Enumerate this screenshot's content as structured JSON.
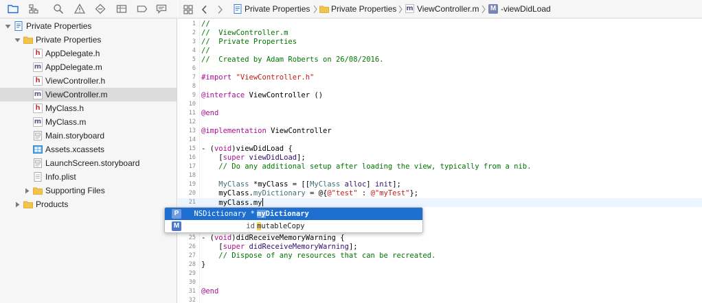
{
  "navigator": {
    "toolbar_icons": [
      "project-navigator-icon",
      "symbol-navigator-icon",
      "find-navigator-icon",
      "issue-navigator-icon",
      "test-navigator-icon",
      "debug-navigator-icon",
      "breakpoint-navigator-icon",
      "report-navigator-icon"
    ],
    "tree": [
      {
        "label": "Private Properties",
        "kind": "project",
        "indent": 0,
        "disclosure": "open"
      },
      {
        "label": "Private Properties",
        "kind": "folder",
        "indent": 1,
        "disclosure": "open"
      },
      {
        "label": "AppDelegate.h",
        "kind": "h",
        "indent": 2
      },
      {
        "label": "AppDelegate.m",
        "kind": "m",
        "indent": 2
      },
      {
        "label": "ViewController.h",
        "kind": "h",
        "indent": 2
      },
      {
        "label": "ViewController.m",
        "kind": "m",
        "indent": 2,
        "selected": true
      },
      {
        "label": "MyClass.h",
        "kind": "h",
        "indent": 2
      },
      {
        "label": "MyClass.m",
        "kind": "m",
        "indent": 2
      },
      {
        "label": "Main.storyboard",
        "kind": "storyboard",
        "indent": 2
      },
      {
        "label": "Assets.xcassets",
        "kind": "assets",
        "indent": 2
      },
      {
        "label": "LaunchScreen.storyboard",
        "kind": "storyboard",
        "indent": 2
      },
      {
        "label": "Info.plist",
        "kind": "plist",
        "indent": 2
      },
      {
        "label": "Supporting Files",
        "kind": "folder",
        "indent": 2,
        "disclosure": "closed"
      },
      {
        "label": "Products",
        "kind": "folder",
        "indent": 1,
        "disclosure": "closed"
      }
    ]
  },
  "jumpbar": {
    "items": [
      "Private Properties",
      "Private Properties",
      "ViewController.m",
      "-viewDidLoad"
    ],
    "method_badge": "M"
  },
  "editor": {
    "lines": [
      {
        "n": "1",
        "tokens": [
          [
            "c-comment",
            "//"
          ]
        ]
      },
      {
        "n": "2",
        "tokens": [
          [
            "c-comment",
            "//  ViewController.m"
          ]
        ]
      },
      {
        "n": "3",
        "tokens": [
          [
            "c-comment",
            "//  Private Properties"
          ]
        ]
      },
      {
        "n": "4",
        "tokens": [
          [
            "c-comment",
            "//"
          ]
        ]
      },
      {
        "n": "5",
        "tokens": [
          [
            "c-comment",
            "//  Created by Adam Roberts on 26/08/2016."
          ]
        ]
      },
      {
        "n": "6",
        "tokens": []
      },
      {
        "n": "7",
        "tokens": [
          [
            "c-kw",
            "#import "
          ],
          [
            "c-str",
            "\"ViewController.h\""
          ]
        ]
      },
      {
        "n": "8",
        "tokens": []
      },
      {
        "n": "9",
        "tokens": [
          [
            "c-kw",
            "@interface "
          ],
          [
            "c-plain",
            "ViewController ()"
          ]
        ]
      },
      {
        "n": "10",
        "tokens": []
      },
      {
        "n": "11",
        "tokens": [
          [
            "c-kw",
            "@end"
          ]
        ]
      },
      {
        "n": "12",
        "tokens": []
      },
      {
        "n": "13",
        "tokens": [
          [
            "c-kw",
            "@implementation "
          ],
          [
            "c-plain",
            "ViewController"
          ]
        ]
      },
      {
        "n": "14",
        "tokens": []
      },
      {
        "n": "15",
        "tokens": [
          [
            "c-plain",
            "- ("
          ],
          [
            "c-kw",
            "void"
          ],
          [
            "c-plain",
            ")viewDidLoad {"
          ]
        ]
      },
      {
        "n": "16",
        "tokens": [
          [
            "c-plain",
            "    ["
          ],
          [
            "c-kw",
            "super "
          ],
          [
            "c-meth",
            "viewDidLoad"
          ],
          [
            "c-plain",
            "];"
          ]
        ]
      },
      {
        "n": "17",
        "tokens": [
          [
            "c-comment",
            "    // Do any additional setup after loading the view, typically from a nib."
          ]
        ]
      },
      {
        "n": "18",
        "tokens": []
      },
      {
        "n": "19",
        "tokens": [
          [
            "c-plain",
            "    "
          ],
          [
            "c-prop",
            "MyClass"
          ],
          [
            "c-plain",
            " *myClass = [["
          ],
          [
            "c-prop",
            "MyClass"
          ],
          [
            "c-plain",
            " "
          ],
          [
            "c-meth",
            "alloc"
          ],
          [
            "c-plain",
            "] "
          ],
          [
            "c-meth",
            "init"
          ],
          [
            "c-plain",
            "];"
          ]
        ]
      },
      {
        "n": "20",
        "tokens": [
          [
            "c-plain",
            "    myClass."
          ],
          [
            "c-prop",
            "myDictionary"
          ],
          [
            "c-plain",
            " = @{"
          ],
          [
            "c-str",
            "@\"test\""
          ],
          [
            "c-plain",
            " : "
          ],
          [
            "c-str",
            "@\"myTest\""
          ],
          [
            "c-plain",
            "};"
          ]
        ]
      },
      {
        "n": "21",
        "tokens": [
          [
            "c-plain",
            "    myClass.my"
          ]
        ],
        "current": true
      },
      {
        "n": "22",
        "tokens": []
      },
      {
        "n": "23",
        "tokens": []
      },
      {
        "n": "24",
        "tokens": []
      },
      {
        "n": "25",
        "tokens": [
          [
            "c-plain",
            "- ("
          ],
          [
            "c-kw",
            "void"
          ],
          [
            "c-plain",
            ")didReceiveMemoryWarning {"
          ]
        ]
      },
      {
        "n": "26",
        "tokens": [
          [
            "c-plain",
            "    ["
          ],
          [
            "c-kw",
            "super "
          ],
          [
            "c-meth",
            "didReceiveMemoryWarning"
          ],
          [
            "c-plain",
            "];"
          ]
        ]
      },
      {
        "n": "27",
        "tokens": [
          [
            "c-comment",
            "    // Dispose of any resources that can be recreated."
          ]
        ]
      },
      {
        "n": "28",
        "tokens": [
          [
            "c-plain",
            "}"
          ]
        ]
      },
      {
        "n": "29",
        "tokens": []
      },
      {
        "n": "30",
        "tokens": []
      },
      {
        "n": "31",
        "tokens": [
          [
            "c-kw",
            "@end"
          ]
        ]
      },
      {
        "n": "32",
        "tokens": []
      }
    ]
  },
  "completion": {
    "items": [
      {
        "badge": "P",
        "badge_color": "#4a77c6",
        "type": "NSDictionary *",
        "match": "my",
        "rest": "Dictionary",
        "selected": true
      },
      {
        "badge": "M",
        "badge_color": "#4a77c6",
        "type": "id",
        "match": "m",
        "rest": "utableCopy",
        "selected": false
      }
    ]
  },
  "colors": {
    "comment": "#007400",
    "keyword": "#aa0d91",
    "string": "#c41a16",
    "selection": "#1f6fd1"
  }
}
